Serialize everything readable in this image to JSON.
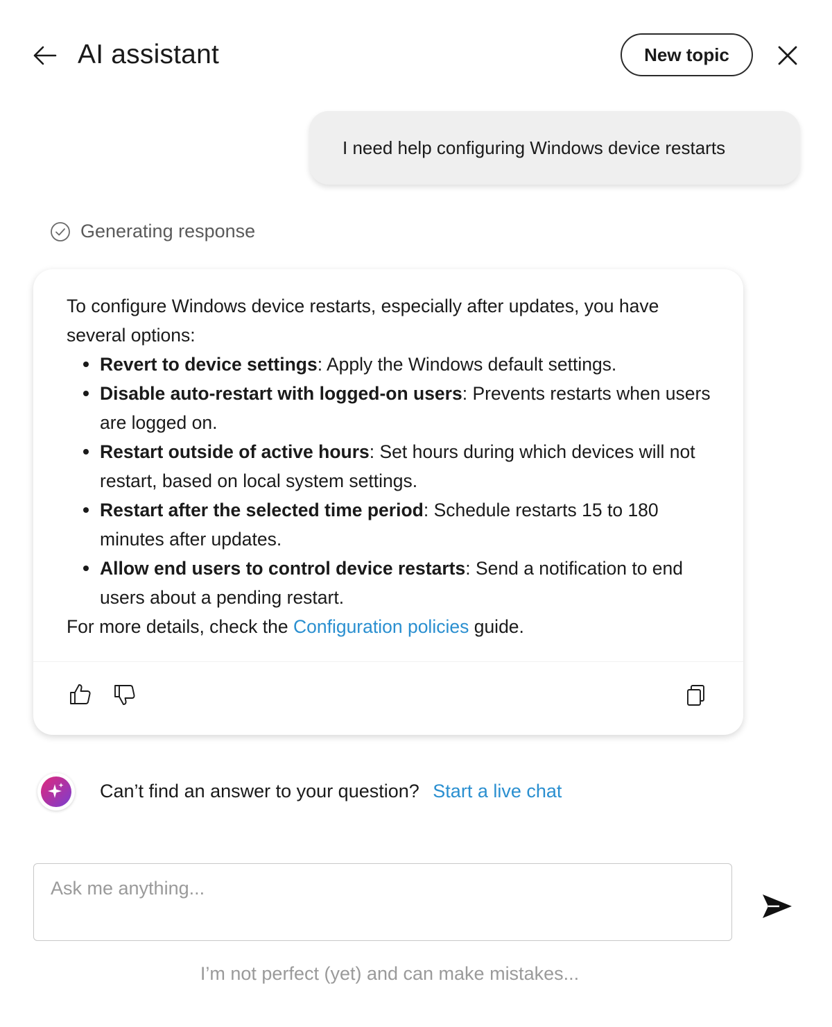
{
  "header": {
    "title": "AI assistant",
    "new_topic_label": "New topic",
    "back_icon": "arrow-left-icon",
    "close_icon": "close-icon"
  },
  "conversation": {
    "user_message": "I need help configuring Windows device restarts",
    "status_text": "Generating response",
    "response": {
      "intro": "To configure Windows device restarts, especially after updates, you have several options:",
      "items": [
        {
          "title": "Revert to device settings",
          "text": ": Apply the Windows default settings."
        },
        {
          "title": "Disable auto-restart with logged-on users",
          "text": ": Prevents restarts when users are logged on."
        },
        {
          "title": "Restart outside of active hours",
          "text": ": Set hours during which devices will not restart, based on local system settings."
        },
        {
          "title": "Restart after the selected time period",
          "text": ": Schedule restarts 15 to 180 minutes after updates."
        },
        {
          "title": "Allow end users to control device restarts",
          "text": ": Send a notification to end users about a pending restart."
        }
      ],
      "outro_before": "For more details, check the ",
      "outro_link": "Configuration policies",
      "outro_after": " guide."
    },
    "actions": {
      "thumbs_up_icon": "thumbs-up-icon",
      "thumbs_down_icon": "thumbs-down-icon",
      "copy_icon": "copy-icon"
    }
  },
  "live_chat": {
    "prompt": "Can’t find an answer to your question?",
    "link_label": "Start a live chat",
    "avatar_icon": "sparkle-icon"
  },
  "composer": {
    "placeholder": "Ask me anything...",
    "value": "",
    "send_icon": "send-icon"
  },
  "disclaimer": "I’m not perfect (yet) and can make mistakes...",
  "colors": {
    "link": "#2a8fd0",
    "user_bubble": "#efefef",
    "avatar_gradient_start": "#e0287a",
    "avatar_gradient_end": "#7a3fd0"
  }
}
